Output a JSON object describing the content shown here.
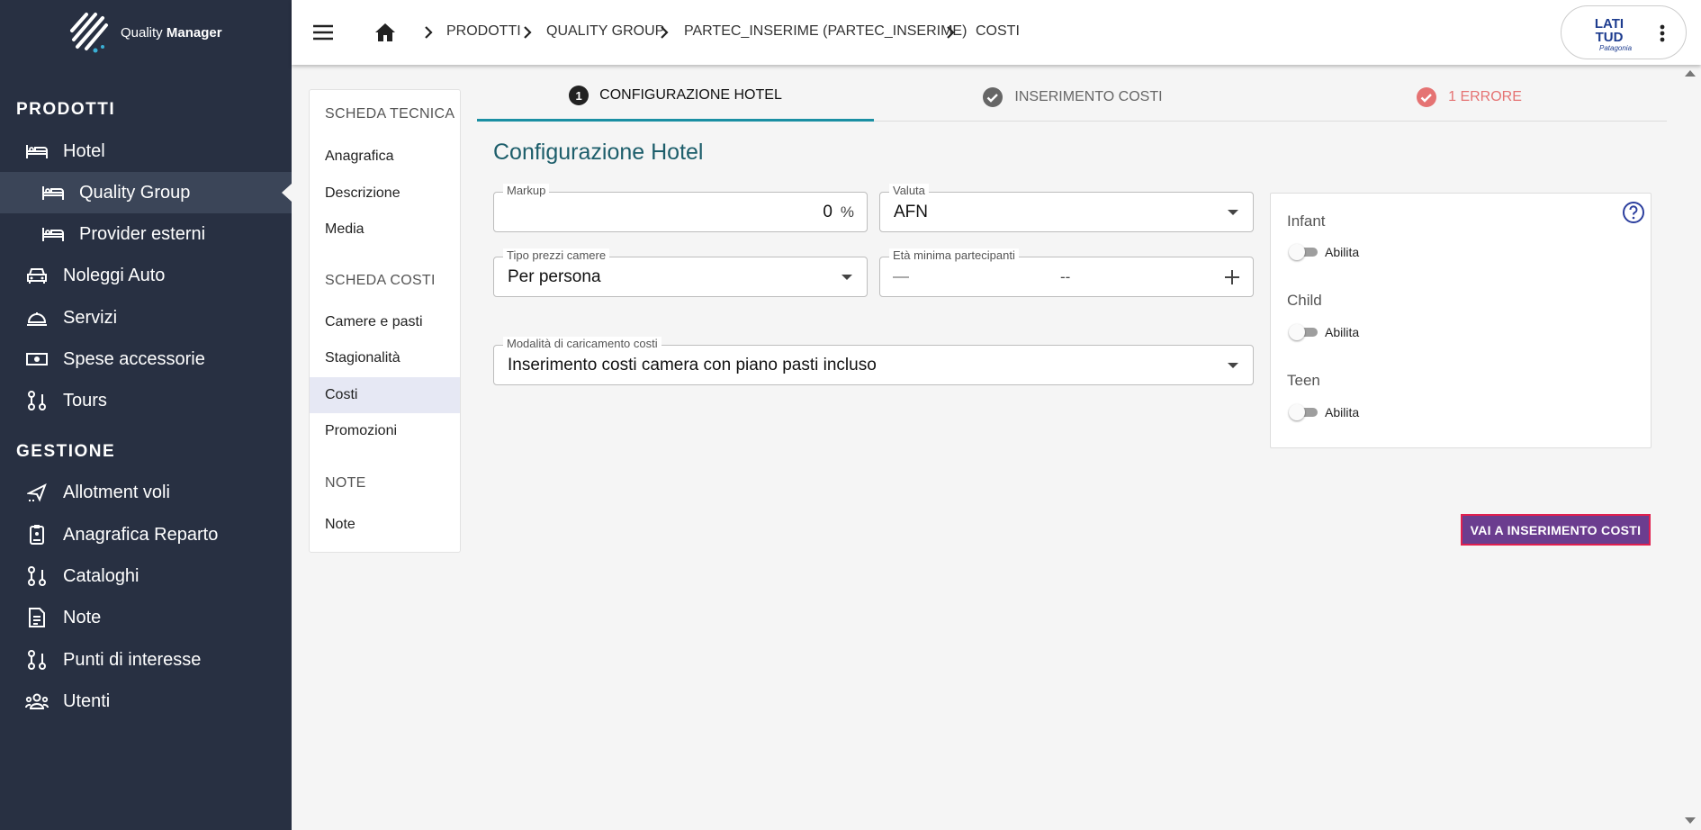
{
  "app": {
    "name_light": "Quality",
    "name_bold": "Manager"
  },
  "sidebar": {
    "section_products": "PRODOTTI",
    "section_management": "GESTIONE",
    "items": [
      {
        "label": "Hotel",
        "icon": "bed-icon"
      },
      {
        "label": "Quality Group",
        "icon": "bed-icon"
      },
      {
        "label": "Provider esterni",
        "icon": "bed-icon"
      },
      {
        "label": "Noleggi Auto",
        "icon": "car-icon"
      },
      {
        "label": "Servizi",
        "icon": "room-service-icon"
      },
      {
        "label": "Spese accessorie",
        "icon": "money-icon"
      },
      {
        "label": "Tours",
        "icon": "route-icon"
      },
      {
        "label": "Allotment voli",
        "icon": "flight-icon"
      },
      {
        "label": "Anagrafica Reparto",
        "icon": "badge-icon"
      },
      {
        "label": "Cataloghi",
        "icon": "route-icon"
      },
      {
        "label": "Note",
        "icon": "note-icon"
      },
      {
        "label": "Punti di interesse",
        "icon": "route-icon"
      },
      {
        "label": "Utenti",
        "icon": "users-icon"
      }
    ]
  },
  "breadcrumb": [
    "PRODOTTI",
    "QUALITY GROUP",
    "PARTEC_INSERIME (PARTEC_INSERIME)",
    "COSTI"
  ],
  "user": {
    "logo_line1": "LATI",
    "logo_line2": "TUD",
    "logo_line3": "Patagonia"
  },
  "side_menu": {
    "section1": "SCHEDA TECNICA",
    "section1_items": [
      "Anagrafica",
      "Descrizione",
      "Media"
    ],
    "section2": "SCHEDA COSTI",
    "section2_items": [
      "Camere e pasti",
      "Stagionalità",
      "Costi",
      "Promozioni"
    ],
    "section3": "NOTE",
    "section3_items": [
      "Note"
    ],
    "selected": "Costi"
  },
  "stepper": {
    "step1_num": "1",
    "step1": "CONFIGURAZIONE HOTEL",
    "step2": "INSERIMENTO COSTI",
    "step3": "1 ERRORE"
  },
  "form": {
    "title": "Configurazione Hotel",
    "markup_label": "Markup",
    "markup_value": "0",
    "markup_unit": "%",
    "currency_label": "Valuta",
    "currency_value": "AFN",
    "price_type_label": "Tipo prezzi camere",
    "price_type_value": "Per persona",
    "min_age_label": "Età minima partecipanti",
    "min_age_value": "--",
    "load_mode_label": "Modalità di caricamento costi",
    "load_mode_value": "Inserimento costi camera con piano pasti incluso"
  },
  "ages": {
    "infant": "Infant",
    "child": "Child",
    "teen": "Teen",
    "enable": "Abilita"
  },
  "actions": {
    "go_costs": "VAI A INSERIMENTO COSTI"
  },
  "colors": {
    "sidebar": "#283042",
    "accent": "#1a8fa3",
    "title": "#1d5e6b",
    "error": "#e57373",
    "button": "#6b3d8f"
  }
}
